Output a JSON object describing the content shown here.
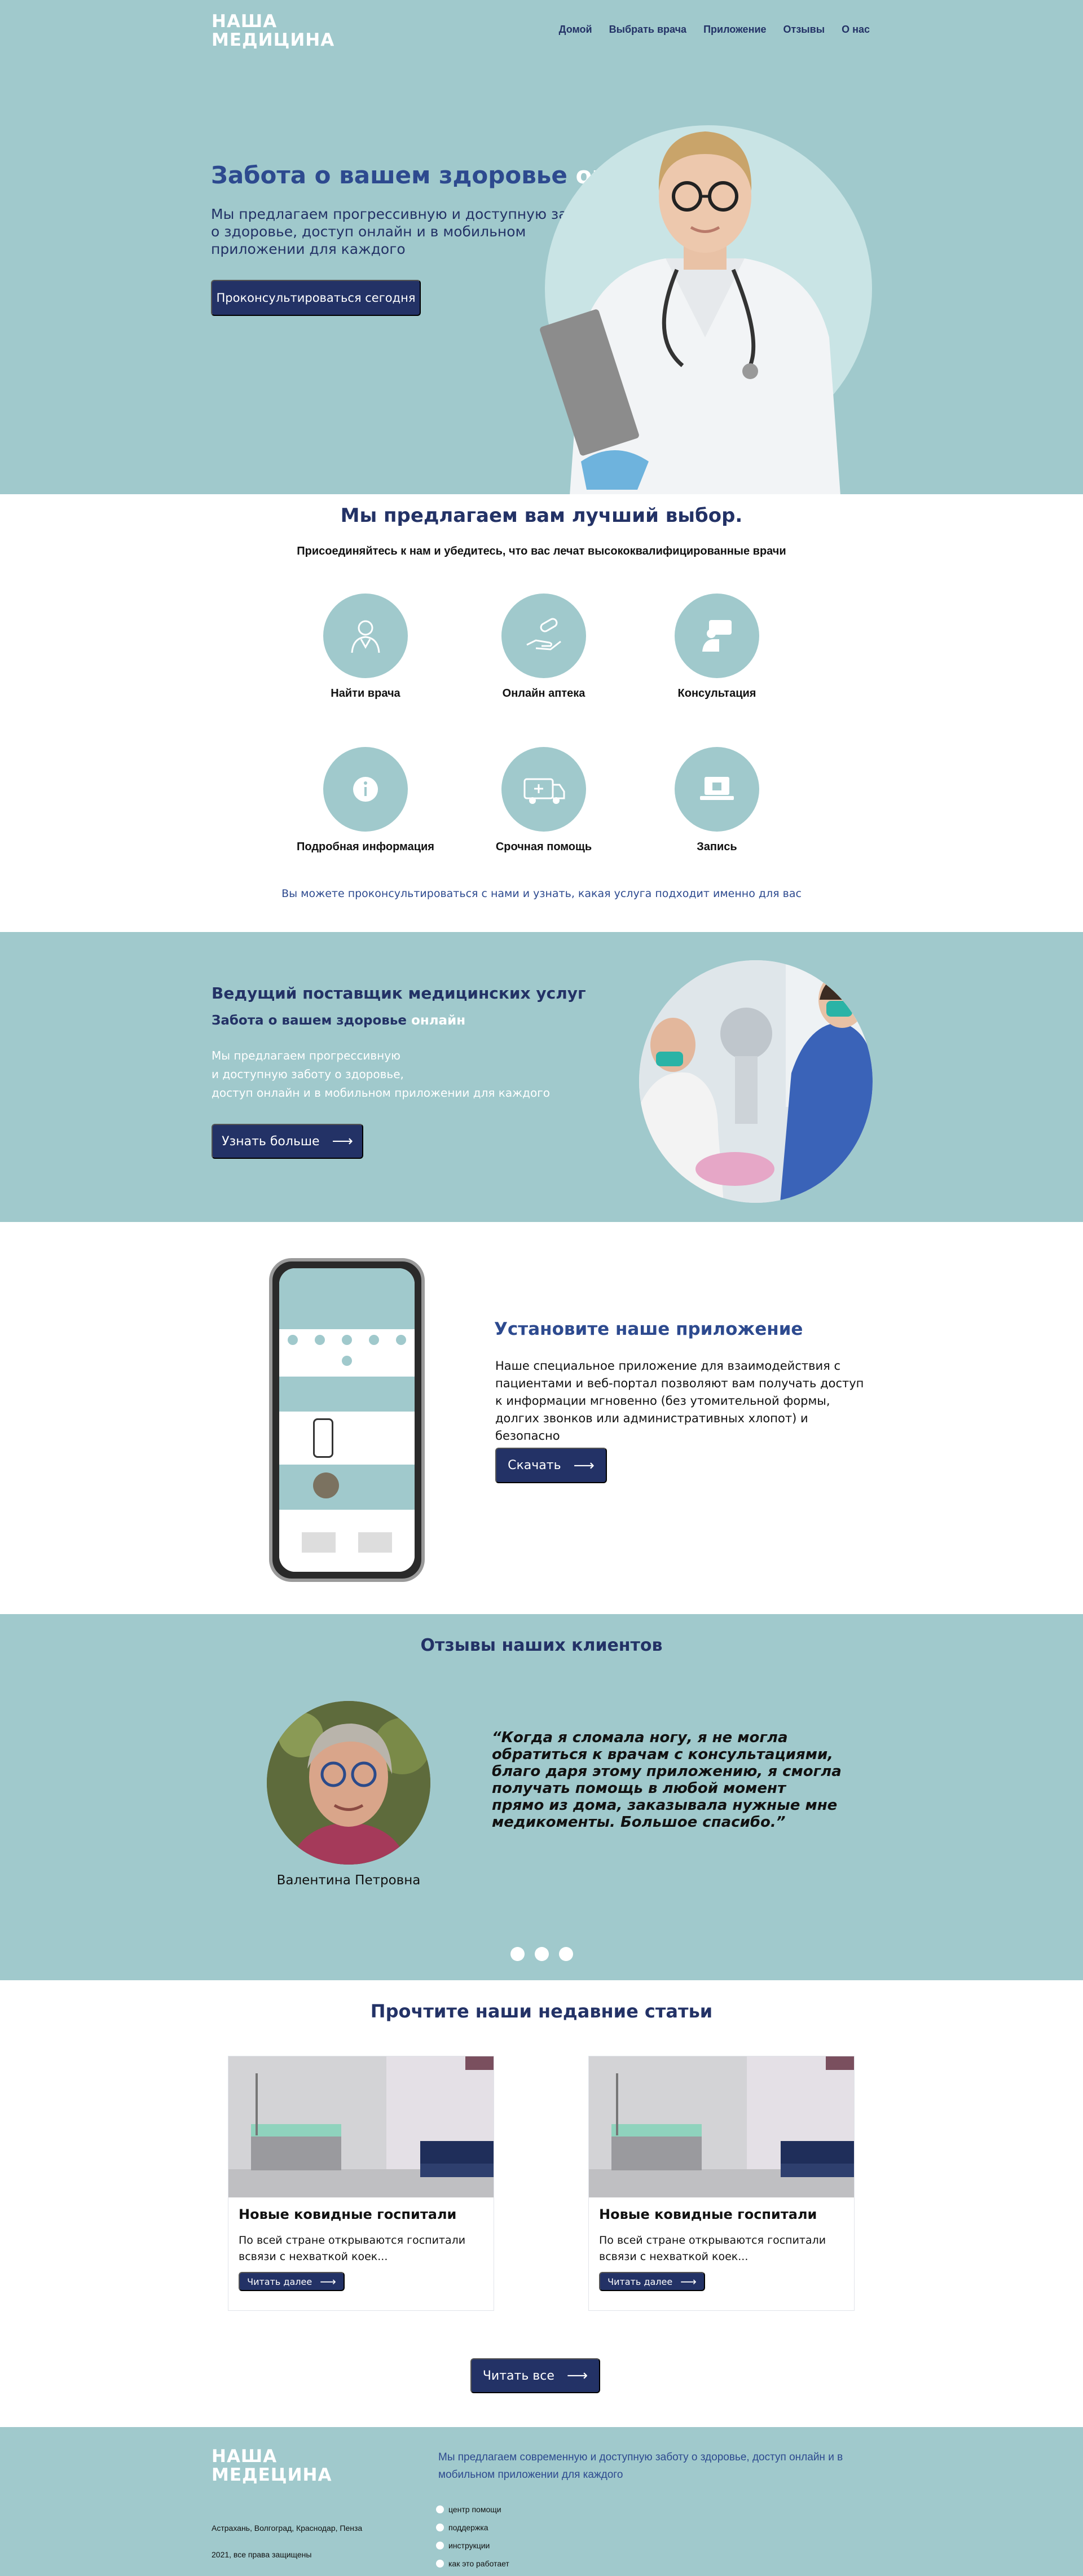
{
  "brand": {
    "logo_line1": "НАША",
    "logo_line2": "МЕДИЦИНА"
  },
  "nav": [
    "Домой",
    "Выбрать врача",
    "Приложение",
    "Отзывы",
    "О нас"
  ],
  "hero": {
    "title_main": "Забота о вашем здоровье ",
    "title_accent": "онлайн",
    "subtitle": "Мы предлагаем прогрессивную и доступную заботу о здоровье, доступ онлайн и в мобильном приложении для каждого",
    "cta": "Проконсультироваться сегодня"
  },
  "services": {
    "title": "Мы предлагаем вам лучший выбор.",
    "subtitle": "Присоединяйтесь к нам и убедитесь, что вас лечат высококвалифицированные врачи",
    "items": [
      {
        "label": "Найти врача",
        "icon": "doctor-icon"
      },
      {
        "label": "Онлайн аптека",
        "icon": "pill-hand-icon"
      },
      {
        "label": "Консультация",
        "icon": "consultation-icon"
      },
      {
        "label": "Подробная информация",
        "icon": "info-icon"
      },
      {
        "label": "Срочная помощь",
        "icon": "ambulance-icon"
      },
      {
        "label": "Запись",
        "icon": "laptop-icon"
      }
    ],
    "note": "Вы можете проконсультироваться с нами и узнать, какая услуга подходит именно для вас"
  },
  "provider": {
    "title": "Ведущий поставщик медицинских услуг",
    "sub_main": "Забота о вашем здоровье ",
    "sub_accent": "онлайн",
    "text_line1": "Мы предлагаем прогрессивную",
    "text_line2": "и доступную заботу о здоровье,",
    "text_line3": "доступ онлайн и в мобильном приложении для каждого",
    "button": "Узнать больше"
  },
  "app": {
    "title": "Установите наше приложение",
    "text": "Наше специальное приложение для взаимодействия с пациентами и веб-портал позволяют вам получать доступ к информации мгновенно (без утомительной формы, долгих звонков или административных хлопот) и безопасно",
    "button": "Скачать"
  },
  "reviews": {
    "title": "Отзывы наших клиентов",
    "name": "Валентина Петровна",
    "quote": "“Когда я сломала ногу, я не могла обратиться к врачам с консультациями, благо даря этому приложению, я смогла получать помощь в любой момент прямо из дома, заказывала нужные мне медикоменты. Большое спасибо.”",
    "dots_count": 3
  },
  "articles": {
    "title": "Прочтите наши недавние статьи",
    "cards": [
      {
        "title": "Новые ковидные госпитали",
        "text": "По всей стране открываются госпитали всвязи с нехваткой коек...",
        "button": "Читать далее"
      },
      {
        "title": "Новые ковидные госпитали",
        "text": "По всей стране открываются госпитали всвязи с нехваткой коек...",
        "button": "Читать далее"
      }
    ],
    "all_button": "Читать все"
  },
  "footer": {
    "logo_line1": "НАША",
    "logo_line2": "МЕДЕЦИНА",
    "tagline": "Мы предлагаем современную и доступную заботу о здоровье, доступ онлайн и в мобильном приложении для каждого",
    "cities": "Астрахань, Волгоград, Краснодар, Пенза",
    "rights": "2021, все права защищены",
    "links": [
      "центр помощи",
      "поддержка",
      "инструкции",
      "как это работает"
    ]
  },
  "colors": {
    "teal": "#a0c9cc",
    "navy": "#233266",
    "blue_text": "#2d4a8f"
  }
}
